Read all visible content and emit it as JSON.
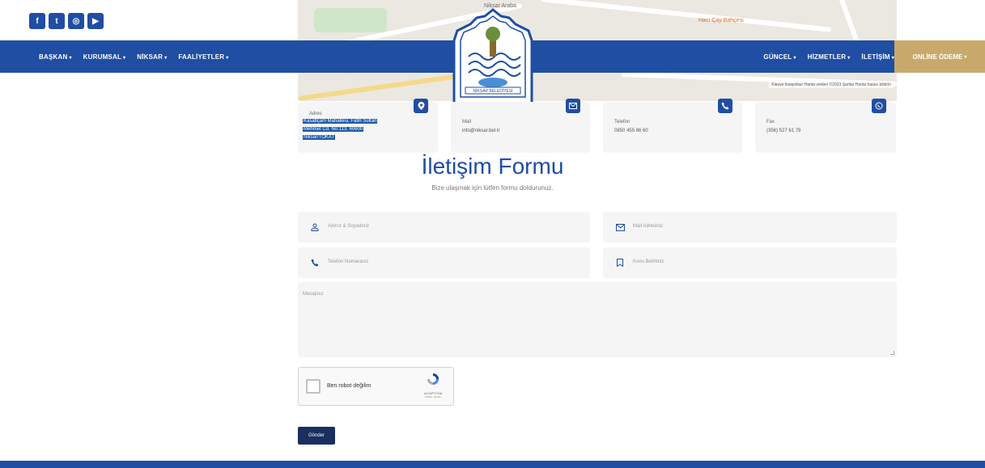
{
  "colors": {
    "primary": "#1f4ea2",
    "accent": "#c9a96b",
    "submit": "#1a2f60",
    "field_bg": "#f5f5f6"
  },
  "social": [
    {
      "icon": "facebook-icon",
      "glyph": "f"
    },
    {
      "icon": "twitter-icon",
      "glyph": "t"
    },
    {
      "icon": "instagram-icon",
      "glyph": "◎"
    },
    {
      "icon": "youtube-icon",
      "glyph": "▶"
    }
  ],
  "nav": {
    "left": [
      "BAŞKAN",
      "KURUMSAL",
      "NİKSAR",
      "FAALİYETLER"
    ],
    "right": [
      "GÜNCEL",
      "HİZMETLER",
      "İLETİŞİM"
    ],
    "cta": "ONLİNE ÖDEME"
  },
  "map": {
    "pois": [
      "Niksar Araba",
      "Hacı Çay Bahçesi"
    ],
    "attribution": "Klavye kısayolları  Harita verileri ©2023  Şartlar  Harita hatası bildirin"
  },
  "logo": {
    "text": "NİKSAR BELEDİYESİ"
  },
  "cards": {
    "address": {
      "label": "Adres",
      "lines": [
        "Kasatlçam Mahallesi, Fatih Sultan",
        "Mehmet Cd. No:113, 60600",
        "Niksar/TOKAT"
      ]
    },
    "mail": {
      "label": "Mail",
      "value": "info@niksar.bel.tr"
    },
    "phone": {
      "label": "Telefon",
      "value": "0850 455 86 60"
    },
    "fax": {
      "label": "Fax",
      "value": "(356) 527 61 79"
    }
  },
  "form": {
    "title": "İletişim Formu",
    "subtitle": "Bize ulaşmak için lütfen formu doldurunuz.",
    "name_placeholder": "Adınız & Soyadınız",
    "email_placeholder": "Mail Adresiniz",
    "phone_placeholder": "Telefon Numaranız",
    "subject_placeholder": "Konu Belirtiniz",
    "message_placeholder": "Mesajınız",
    "captcha_label": "Ben robot değilim",
    "captcha_brand": "reCAPTCHA",
    "captcha_sub": "Gizlilik - Şartlar",
    "submit_label": "Gönder"
  }
}
